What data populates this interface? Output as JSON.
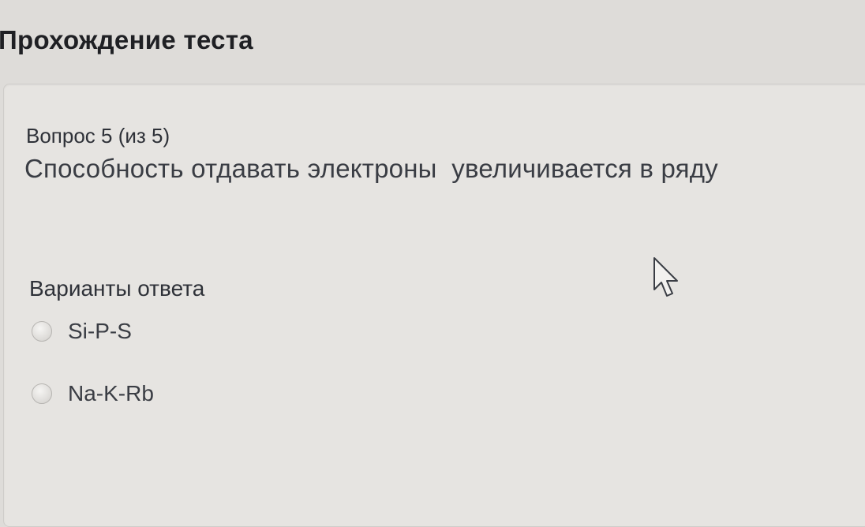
{
  "page": {
    "title": "Прохождение теста"
  },
  "question": {
    "number_label": "Вопрос 5 (из 5)",
    "text": "Способность отдавать электроны  увеличивается в ряду"
  },
  "answers": {
    "heading": "Варианты ответа",
    "options": [
      {
        "label": "Si-P-S",
        "selected": false
      },
      {
        "label": "Na-K-Rb",
        "selected": false
      }
    ]
  },
  "icons": {
    "cursor": "mouse-pointer-icon",
    "radio": "radio-button-icon"
  },
  "colors": {
    "background": "#dedcd9",
    "panel": "#e6e4e1",
    "text": "#3a3d44"
  }
}
